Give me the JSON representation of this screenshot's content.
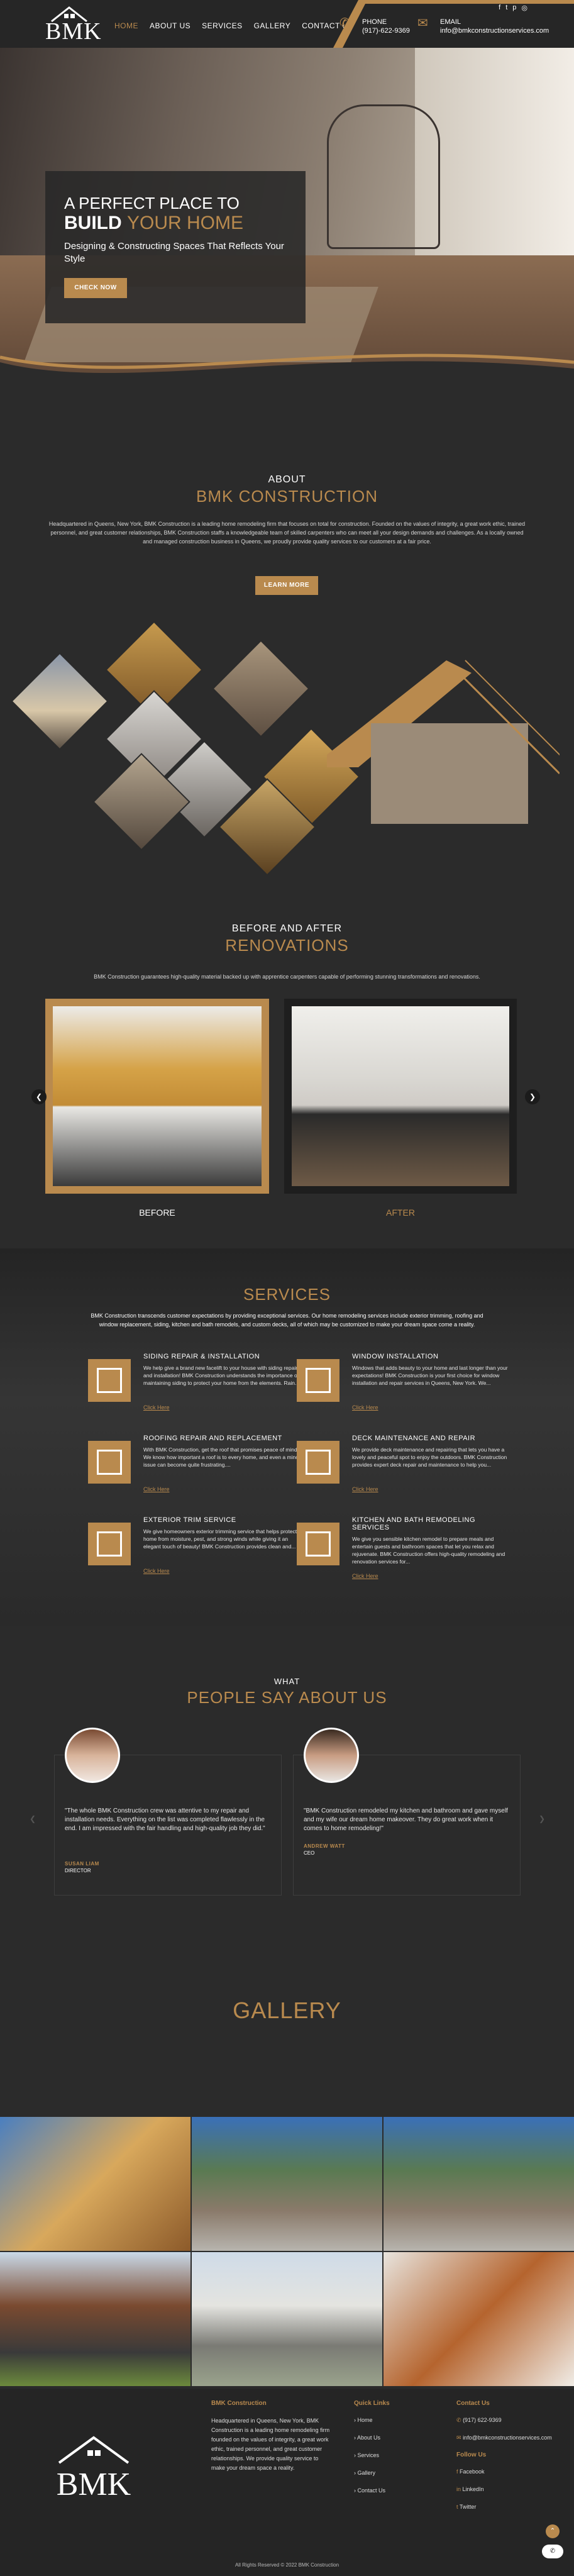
{
  "header": {
    "logo": "BMK",
    "nav": [
      "HOME",
      "ABOUT US",
      "SERVICES",
      "GALLERY",
      "CONTACT US"
    ],
    "phone_label": "PHONE",
    "phone": "(917)-622-9369",
    "email_label": "EMAIL",
    "email": "info@bmkconstructionservices.com"
  },
  "hero": {
    "line1": "A PERFECT PLACE TO",
    "line2a": "BUILD",
    "line2b": "YOUR HOME",
    "tagline": "Designing & Constructing Spaces That Reflects Your Style",
    "cta": "CHECK NOW"
  },
  "about": {
    "sub": "ABOUT",
    "title": "BMK CONSTRUCTION",
    "text": "Headquartered in Queens, New York, BMK Construction is a leading home remodeling firm that focuses on total for construction. Founded on the values of integrity, a great work ethic, trained personnel, and great customer relationships, BMK Construction staffs a knowledgeable team of skilled carpenters who can meet all your design demands and challenges. As a locally owned and managed construction business in Queens, we proudly provide quality services to our customers at a fair price.",
    "cta": "LEARN MORE"
  },
  "ba": {
    "sub": "BEFORE AND AFTER",
    "title": "RENOVATIONS",
    "text": "BMK Construction guarantees high-quality material backed up with apprentice carpenters capable of performing stunning transformations and renovations.",
    "before": "BEFORE",
    "after": "AFTER"
  },
  "services": {
    "title": "SERVICES",
    "intro": "BMK Construction transcends customer expectations by providing exceptional services. Our home remodeling services include exterior trimming, roofing and window replacement, siding, kitchen and bath remodels, and custom decks, all of which may be customized to make your dream space come a reality.",
    "items": [
      {
        "title": "SIDING REPAIR & INSTALLATION",
        "text": "We help give a brand new facelift to your house with siding repair and installation! BMK Construction understands the importance of maintaining siding to protect your home from the elements. Rain...",
        "link": "Click Here"
      },
      {
        "title": "WINDOW INSTALLATION",
        "text": "Windows that adds beauty to your home and last longer than your expectations! BMK Construction is your first choice for window installation and repair services in Queens, New York. We...",
        "link": "Click Here"
      },
      {
        "title": "ROOFING REPAIR AND REPLACEMENT",
        "text": "With BMK Construction, get the roof that promises peace of mind! We know how important a roof is to every home, and even a minor issue can become quite frustrating....",
        "link": "Click Here"
      },
      {
        "title": "DECK MAINTENANCE AND REPAIR",
        "text": "We provide deck maintenance and repairing that lets you have a lovely and peaceful spot to enjoy the outdoors. BMK Construction provides expert deck repair and maintenance to help you...",
        "link": "Click Here"
      },
      {
        "title": "EXTERIOR TRIM SERVICE",
        "text": "We give homeowners exterior trimming service that helps protect home from moisture, pest, and strong winds while giving it an elegant touch of beauty! BMK Construction provides clean and...",
        "link": "Click Here"
      },
      {
        "title": "KITCHEN AND BATH REMODELING SERVICES",
        "text": "We give you sensible kitchen remodel to prepare meals and entertain guests and bathroom spaces that let you relax and rejuvenate. BMK Construction offers high-quality remodeling and renovation services for...",
        "link": "Click Here"
      }
    ]
  },
  "testimonials": {
    "sub": "WHAT",
    "title": "PEOPLE SAY ABOUT US",
    "items": [
      {
        "quote": "\"The whole BMK Construction crew was attentive to my repair and installation needs. Everything on the list was completed flawlessly in the end. I am impressed with the fair handling and high-quality job they did.\"",
        "name": "SUSAN LIAM",
        "role": "DIRECTOR"
      },
      {
        "quote": "\"BMK Construction remodeled my kitchen and bathroom and gave myself and my wife our dream home makeover. They do great work when it comes to home remodeling!\"",
        "name": "ANDREW WATT",
        "role": "CEO"
      }
    ]
  },
  "gallery": {
    "title": "GALLERY"
  },
  "footer": {
    "col1_title": "BMK Construction",
    "col1_text": "Headquartered in Queens, New York, BMK Construction is a leading home remodeling firm founded on the values of integrity, a great work ethic, trained personnel, and great customer relationships. We provide quality service to make your dream space a reality.",
    "links_title": "Quick Links",
    "links": [
      "Home",
      "About Us",
      "Services",
      "Gallery",
      "Contact Us"
    ],
    "contact_title": "Contact Us",
    "phone": "(917) 622-9369",
    "email": "info@bmkconstructionservices.com",
    "follow_title": "Follow Us",
    "social": [
      "Facebook",
      "LinkedIn",
      "Twitter"
    ],
    "copyright": "All Rights Reserved © 2022 BMK Construction"
  },
  "colors": {
    "accent": "#b98a4e",
    "background": "#2b2b2b"
  }
}
